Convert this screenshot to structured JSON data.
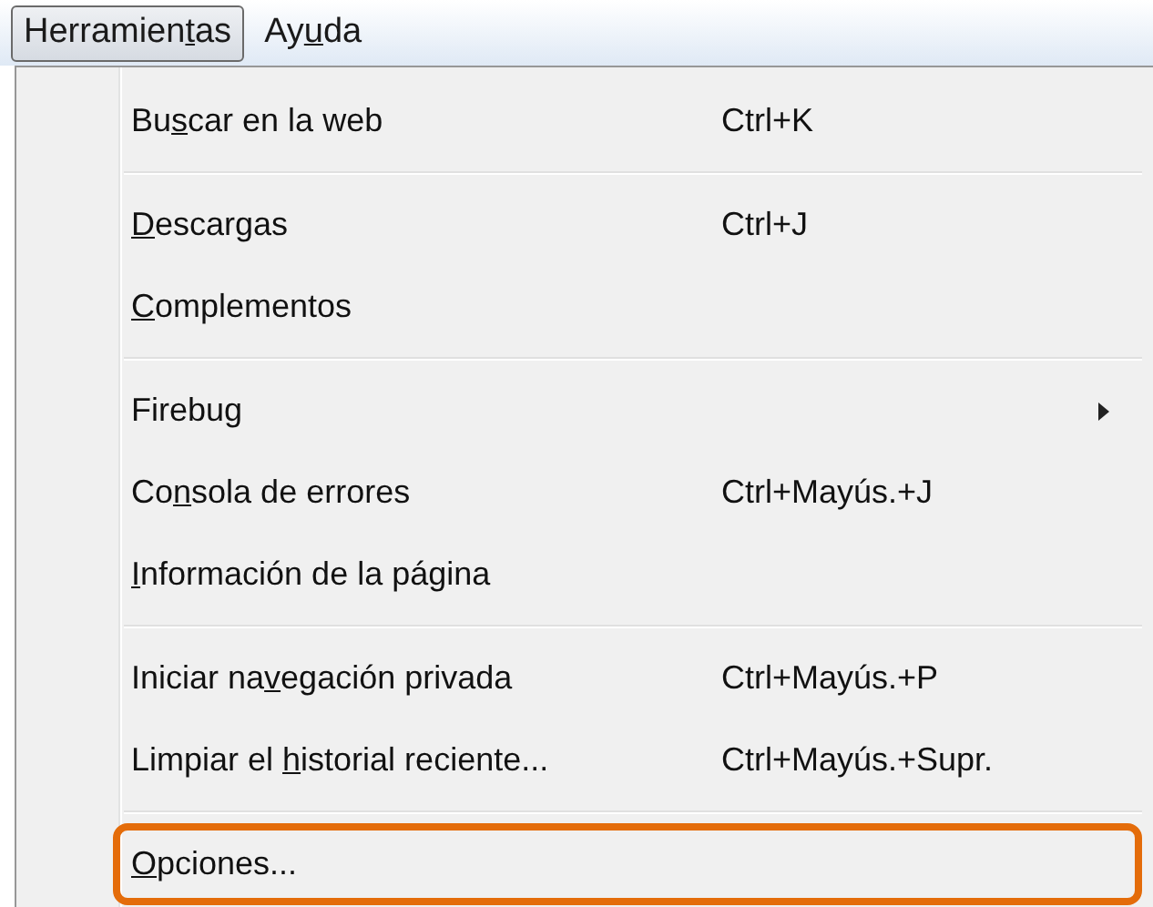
{
  "menubar": [
    {
      "before": "Herramien",
      "access_key": "t",
      "after": "as",
      "selected": true
    },
    {
      "before": "Ay",
      "access_key": "u",
      "after": "da",
      "selected": false
    }
  ],
  "menu": {
    "items": [
      {
        "kind": "item",
        "before": "Bu",
        "access_key": "s",
        "after": "car en la web",
        "shortcut": "Ctrl+K",
        "submenu": false,
        "highlighted": false
      },
      {
        "kind": "separator"
      },
      {
        "kind": "item",
        "access_key": "D",
        "after": "escargas",
        "shortcut": "Ctrl+J",
        "submenu": false,
        "highlighted": false
      },
      {
        "kind": "item",
        "access_key": "C",
        "after": "omplementos",
        "submenu": false,
        "highlighted": false
      },
      {
        "kind": "separator"
      },
      {
        "kind": "item",
        "after": "Firebug",
        "submenu": true,
        "highlighted": false
      },
      {
        "kind": "item",
        "before": "Co",
        "access_key": "n",
        "after": "sola de errores",
        "shortcut": "Ctrl+Mayús.+J",
        "submenu": false,
        "highlighted": false
      },
      {
        "kind": "item",
        "access_key": "I",
        "after": "nformación de la página",
        "submenu": false,
        "highlighted": false
      },
      {
        "kind": "separator"
      },
      {
        "kind": "item",
        "before": "Iniciar na",
        "access_key": "v",
        "after": "egación privada",
        "shortcut": "Ctrl+Mayús.+P",
        "submenu": false,
        "highlighted": false
      },
      {
        "kind": "item",
        "before": "Limpiar el ",
        "access_key": "h",
        "after": "istorial reciente...",
        "shortcut": "Ctrl+Mayús.+Supr.",
        "submenu": false,
        "highlighted": false
      },
      {
        "kind": "separator"
      },
      {
        "kind": "item",
        "access_key": "O",
        "after": "pciones...",
        "submenu": false,
        "highlighted": true
      }
    ]
  }
}
